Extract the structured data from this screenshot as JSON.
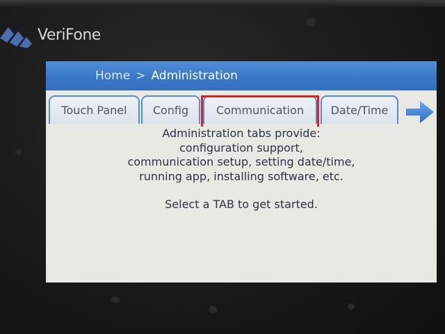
{
  "brand": {
    "name": "VeriFone"
  },
  "header": {
    "home": "Home",
    "separator": ">",
    "current": "Administration"
  },
  "tabs": [
    {
      "label": "Touch Panel"
    },
    {
      "label": "Config"
    },
    {
      "label": "Communication",
      "highlighted": true
    },
    {
      "label": "Date/Time"
    }
  ],
  "next_tab_icon": "right-arrow-icon",
  "content": {
    "lines": [
      "Administration tabs provide:",
      "configuration support,",
      "communication setup, setting date/time,",
      "running app, installing software, etc."
    ],
    "prompt": "Select a TAB to get started."
  },
  "colors": {
    "header_blue": "#3a78c7",
    "tab_border": "#4d8ed6",
    "highlight_red": "#e0201c",
    "screen_bg": "#e9e9e4",
    "text": "#2c3246"
  }
}
